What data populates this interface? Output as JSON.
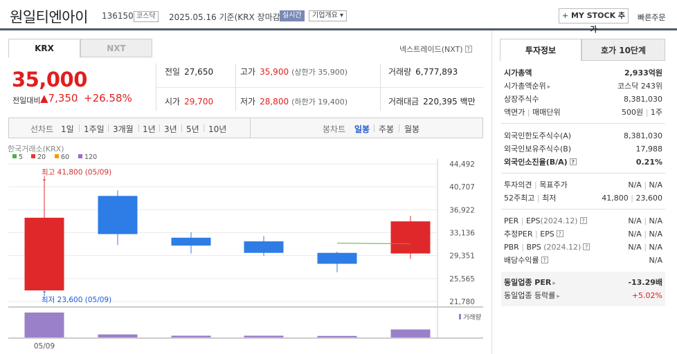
{
  "header": {
    "name": "원일티엔아이",
    "code": "136150",
    "market": "코스닥",
    "date": "2025.05.16 기준(KRX 장마감)",
    "realtime": "실시간",
    "company_info": "기업개요",
    "mystock_plus": "+",
    "mystock": "MY STOCK 추가",
    "quick_order": "빠른주문"
  },
  "exchange_tabs": [
    "KRX",
    "NXT"
  ],
  "nxt_link": "넥스트레이드(NXT)",
  "price": {
    "current": "35,000",
    "change_label": "전일대비",
    "change_amount": "▲7,350",
    "change_percent": "+26.58%"
  },
  "quotes": {
    "prev_close": {
      "label": "전일",
      "value": "27,650"
    },
    "high": {
      "label": "고가",
      "value": "35,900",
      "sub": "(상한가 35,900)"
    },
    "volume": {
      "label": "거래량",
      "value": "6,777,893"
    },
    "open": {
      "label": "시가",
      "value": "29,700"
    },
    "low": {
      "label": "저가",
      "value": "28,800",
      "sub": "(하한가 19,400)"
    },
    "amount": {
      "label": "거래대금",
      "value": "220,395 백만"
    }
  },
  "period_bar": {
    "line_label": "선차트",
    "line_periods": [
      "1일",
      "1주일",
      "3개월",
      "1년",
      "3년",
      "5년",
      "10년"
    ],
    "candle_label": "봉차트",
    "candle_periods": [
      "일봉",
      "주봉",
      "월봉"
    ],
    "active_candle": "일봉"
  },
  "chart_data": {
    "type": "candlestick",
    "title": "한국거래소(KRX)",
    "legend": [
      {
        "name": "5",
        "color": "#4caf50"
      },
      {
        "name": "20",
        "color": "#e53935"
      },
      {
        "name": "60",
        "color": "#ff9800"
      },
      {
        "name": "120",
        "color": "#9c6ad6"
      }
    ],
    "y_ticks": [
      "44,492",
      "40,707",
      "36,922",
      "33,136",
      "29,351",
      "25,565",
      "21,780"
    ],
    "y_tick_values": [
      44492,
      40707,
      36922,
      33136,
      29351,
      25565,
      21780
    ],
    "ylim": [
      21780,
      44492
    ],
    "x_labels": [
      "05/09"
    ],
    "candles": [
      {
        "open": 23600,
        "close": 35600,
        "high": 41800,
        "low": 23600,
        "dir": "up",
        "volume": 100
      },
      {
        "open": 39200,
        "close": 32900,
        "high": 40100,
        "low": 31100,
        "dir": "down",
        "volume": 12
      },
      {
        "open": 32300,
        "close": 31000,
        "high": 33200,
        "low": 29700,
        "dir": "down",
        "volume": 7
      },
      {
        "open": 31700,
        "close": 29800,
        "high": 32600,
        "low": 29300,
        "dir": "down",
        "volume": 7
      },
      {
        "open": 29800,
        "close": 28000,
        "high": 30000,
        "low": 26600,
        "dir": "down",
        "volume": 6
      },
      {
        "open": 29700,
        "close": 35000,
        "high": 35900,
        "low": 28800,
        "dir": "up",
        "volume": 32
      }
    ],
    "ma5": [
      {
        "i": 4,
        "v": 31400
      },
      {
        "i": 5,
        "v": 31300
      }
    ],
    "annotations": {
      "high": "최고 41,800 (05/09)",
      "low": "최저 23,600 (05/09)"
    },
    "volume_label": "거래량"
  },
  "right_panel": {
    "tabs": [
      "투자정보",
      "호가 10단계"
    ],
    "market_cap": {
      "label": "시가총액",
      "value": "2,933억원"
    },
    "cap_rank": {
      "label": "시가총액순위",
      "value": "코스닥 243위"
    },
    "shares": {
      "label": "상장주식수",
      "value": "8,381,030"
    },
    "face": {
      "label": "액면가",
      "label2": "매매단위",
      "value": "500원",
      "value2": "1주"
    },
    "foreign_limit": {
      "label": "외국인한도주식수(A)",
      "value": "8,381,030"
    },
    "foreign_hold": {
      "label": "외국인보유주식수(B)",
      "value": "17,988"
    },
    "foreign_ratio": {
      "label": "외국인소진율(B/A)",
      "value": "0.21%"
    },
    "opinion": {
      "label": "투자의견",
      "label2": "목표주가",
      "value": "N/A",
      "value2": "N/A"
    },
    "w52": {
      "label": "52주최고",
      "label2": "최저",
      "value": "41,800",
      "value2": "23,600"
    },
    "per_eps": {
      "label": "PER",
      "label2": "EPS",
      "date": "(2024.12)",
      "value": "N/A",
      "value2": "N/A"
    },
    "est_per": {
      "label": "추정PER",
      "label2": "EPS",
      "value": "N/A",
      "value2": "N/A"
    },
    "pbr_bps": {
      "label": "PBR",
      "label2": "BPS",
      "date": "(2024.12)",
      "value": "N/A",
      "value2": "N/A"
    },
    "dividend": {
      "label": "배당수익률",
      "value": "N/A"
    },
    "sector_per": {
      "label": "동일업종 PER",
      "value": "-13.29배"
    },
    "sector_rate": {
      "label": "동일업종 등락률",
      "value": "+5.02%"
    }
  }
}
